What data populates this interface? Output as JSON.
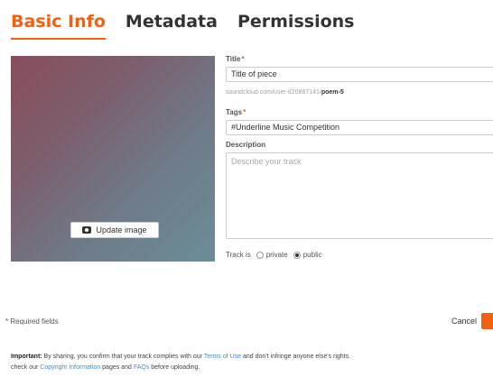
{
  "tabs": [
    {
      "label": "Basic Info",
      "active": true
    },
    {
      "label": "Metadata",
      "active": false
    },
    {
      "label": "Permissions",
      "active": false
    }
  ],
  "artwork": {
    "update_label": "Update image",
    "icon": "camera-icon"
  },
  "form": {
    "title_label": "Title",
    "title_value": "Title of piece",
    "url_prefix": "soundcloud.com/user-820887141/",
    "url_slug": "poem-5",
    "tags_label": "Tags",
    "tags_value": "#Underline Music Competition",
    "description_label": "Description",
    "description_placeholder": "Describe your track",
    "required_mark": "*",
    "privacy": {
      "label": "Track is",
      "options": [
        "private",
        "public"
      ],
      "selected": "public"
    }
  },
  "footer": {
    "required_note": "* Required fields",
    "cancel_label": "Cancel",
    "notice": {
      "line1_strong": "Important:",
      "line1_text": " By sharing, you confirm that your track complies with our ",
      "terms_link": "Terms of Use",
      "line1_tail": " and don't infringe anyone else's rights.",
      "line2_start": "check our ",
      "copyright_link": "Copyright Information",
      "line2_mid": " pages and ",
      "faqs_link": "FAQs",
      "line2_end": " before uploading."
    }
  },
  "colors": {
    "accent": "#f55f12",
    "link": "#4a8cc9"
  }
}
